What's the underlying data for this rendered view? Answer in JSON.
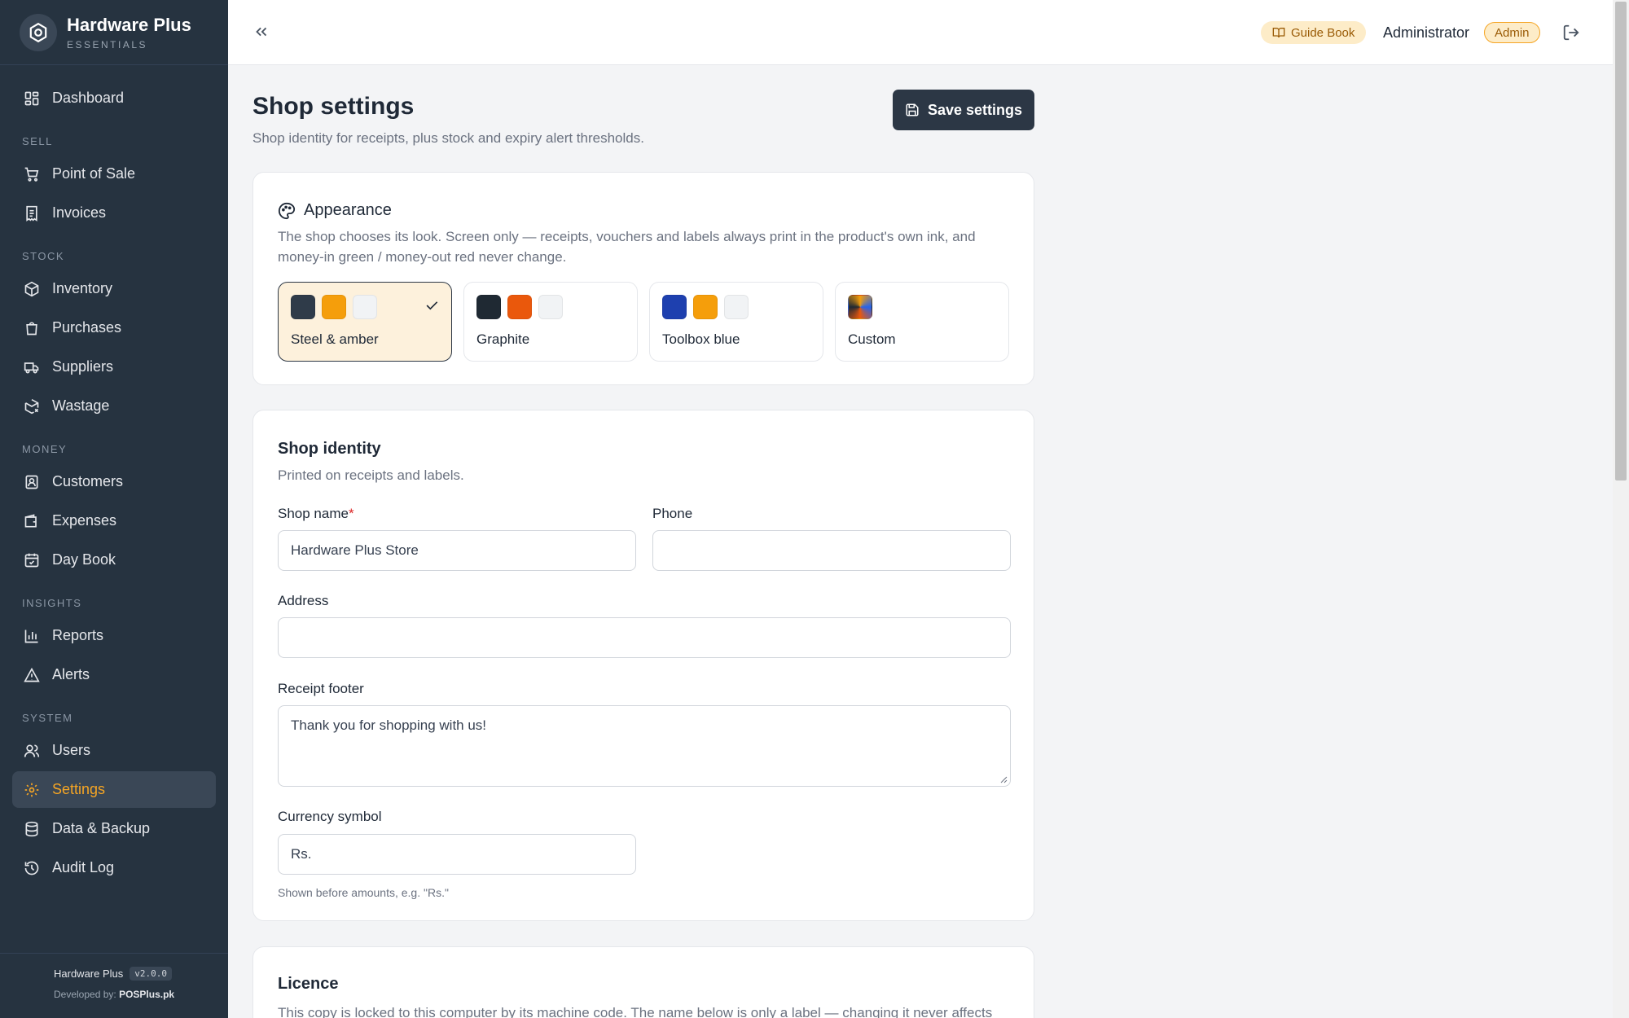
{
  "brand": {
    "title": "Hardware Plus",
    "subtitle": "ESSENTIALS"
  },
  "nav": {
    "dashboard": "Dashboard",
    "sections": {
      "sell": "SELL",
      "stock": "STOCK",
      "money": "MONEY",
      "insights": "INSIGHTS",
      "system": "SYSTEM"
    },
    "pos": "Point of Sale",
    "invoices": "Invoices",
    "inventory": "Inventory",
    "purchases": "Purchases",
    "suppliers": "Suppliers",
    "wastage": "Wastage",
    "customers": "Customers",
    "expenses": "Expenses",
    "daybook": "Day Book",
    "reports": "Reports",
    "alerts": "Alerts",
    "users": "Users",
    "settings": "Settings",
    "backup": "Data & Backup",
    "audit": "Audit Log"
  },
  "footer": {
    "app": "Hardware Plus",
    "version": "v2.0.0",
    "dev_prefix": "Developed by:",
    "dev_name": "POSPlus.pk"
  },
  "topbar": {
    "guide": "Guide Book",
    "user": "Administrator",
    "role": "Admin"
  },
  "page": {
    "title": "Shop settings",
    "subtitle": "Shop identity for receipts, plus stock and expiry alert thresholds.",
    "save": "Save settings"
  },
  "appearance": {
    "title": "Appearance",
    "desc": "The shop chooses its look. Screen only — receipts, vouchers and labels always print in the product's own ink, and money-in green / money-out red never change.",
    "themes": [
      {
        "name": "Steel & amber",
        "selected": true,
        "colors": [
          "#2f3b49",
          "#f59e0b",
          "#f1f3f5"
        ]
      },
      {
        "name": "Graphite",
        "selected": false,
        "colors": [
          "#1f2933",
          "#ea580c",
          "#f1f3f5"
        ]
      },
      {
        "name": "Toolbox blue",
        "selected": false,
        "colors": [
          "#1e40af",
          "#f59e0b",
          "#f1f3f5"
        ]
      },
      {
        "name": "Custom",
        "selected": false
      }
    ]
  },
  "identity": {
    "title": "Shop identity",
    "subtitle": "Printed on receipts and labels.",
    "shop_name_label": "Shop name",
    "required_mark": "*",
    "shop_name_value": "Hardware Plus Store",
    "phone_label": "Phone",
    "phone_value": "",
    "address_label": "Address",
    "address_value": "",
    "footer_label": "Receipt footer",
    "footer_value": "Thank you for shopping with us!",
    "currency_label": "Currency symbol",
    "currency_value": "Rs.",
    "currency_hint": "Shown before amounts, e.g. \"Rs.\""
  },
  "licence": {
    "title": "Licence",
    "desc": "This copy is locked to this computer by its machine code. The name below is only a label — changing it never affects"
  }
}
